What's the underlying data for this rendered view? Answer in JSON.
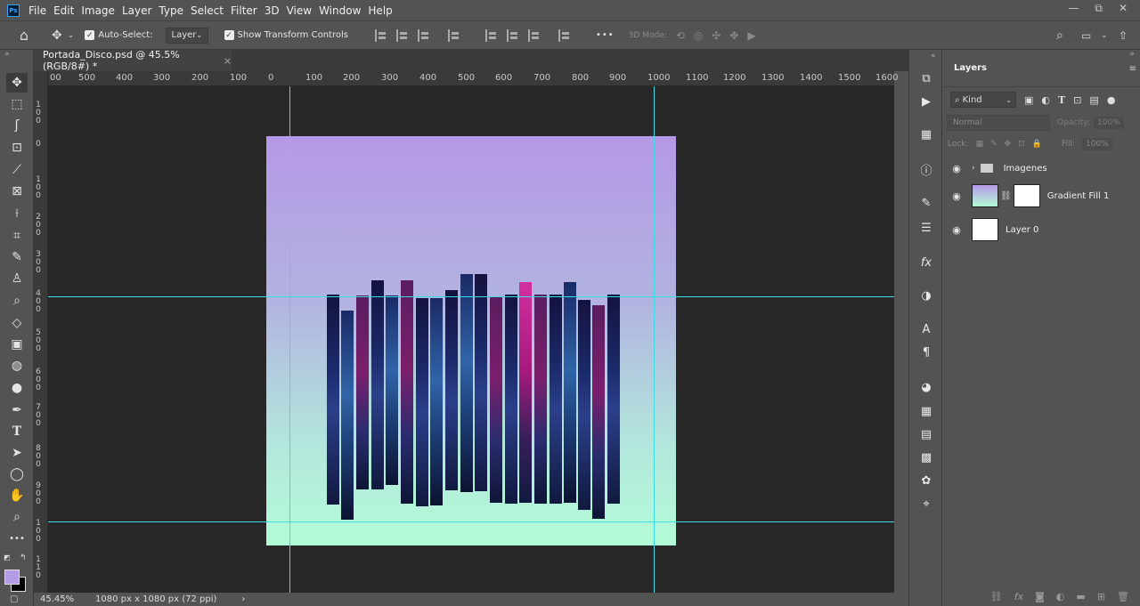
{
  "menu": {
    "items": [
      "File",
      "Edit",
      "Image",
      "Layer",
      "Type",
      "Select",
      "Filter",
      "3D",
      "View",
      "Window",
      "Help"
    ],
    "logo": "Ps"
  },
  "window_controls": {
    "minimize": "—",
    "restore": "⧉",
    "close": "✕"
  },
  "options": {
    "auto_select_label": "Auto-Select:",
    "auto_select_target": "Layer",
    "show_transform_label": "Show Transform Controls",
    "more": "•••",
    "mode_3d_label": "3D Mode:"
  },
  "document": {
    "tab_title": "Portada_Disco.psd @ 45.5% (RGB/8#) *",
    "close": "×"
  },
  "rulers": {
    "horizontal": [
      "00",
      "500",
      "400",
      "300",
      "200",
      "100",
      "0",
      "100",
      "200",
      "300",
      "400",
      "500",
      "600",
      "700",
      "800",
      "900",
      "1000",
      "1100",
      "1200",
      "1300",
      "1400",
      "1500",
      "1600"
    ],
    "vertical": [
      "1 0 0",
      "0",
      "1 0 0",
      "2 0 0",
      "3 0 0",
      "4 0 0",
      "5 0 0",
      "6 0 0",
      "7 0 0",
      "8 0 0",
      "9 0 0",
      "1 0 0",
      "1 1 0"
    ]
  },
  "status": {
    "zoom": "45.45%",
    "dimensions": "1080 px x 1080 px (72 ppi)",
    "arrow": "›"
  },
  "layers_panel": {
    "title": "Layers",
    "filter_kind": "Kind",
    "blend_mode": "Normal",
    "opacity_label": "Opacity:",
    "opacity_value": "100%",
    "lock_label": "Lock:",
    "fill_label": "Fill:",
    "fill_value": "100%",
    "layers": [
      {
        "name": "Imagenes",
        "type": "group"
      },
      {
        "name": "Gradient Fill 1",
        "type": "fill"
      },
      {
        "name": "Layer 0",
        "type": "pixel"
      }
    ]
  },
  "colors": {
    "foreground": "#b49be6",
    "background": "#000000",
    "guide": "#3cdce6"
  }
}
